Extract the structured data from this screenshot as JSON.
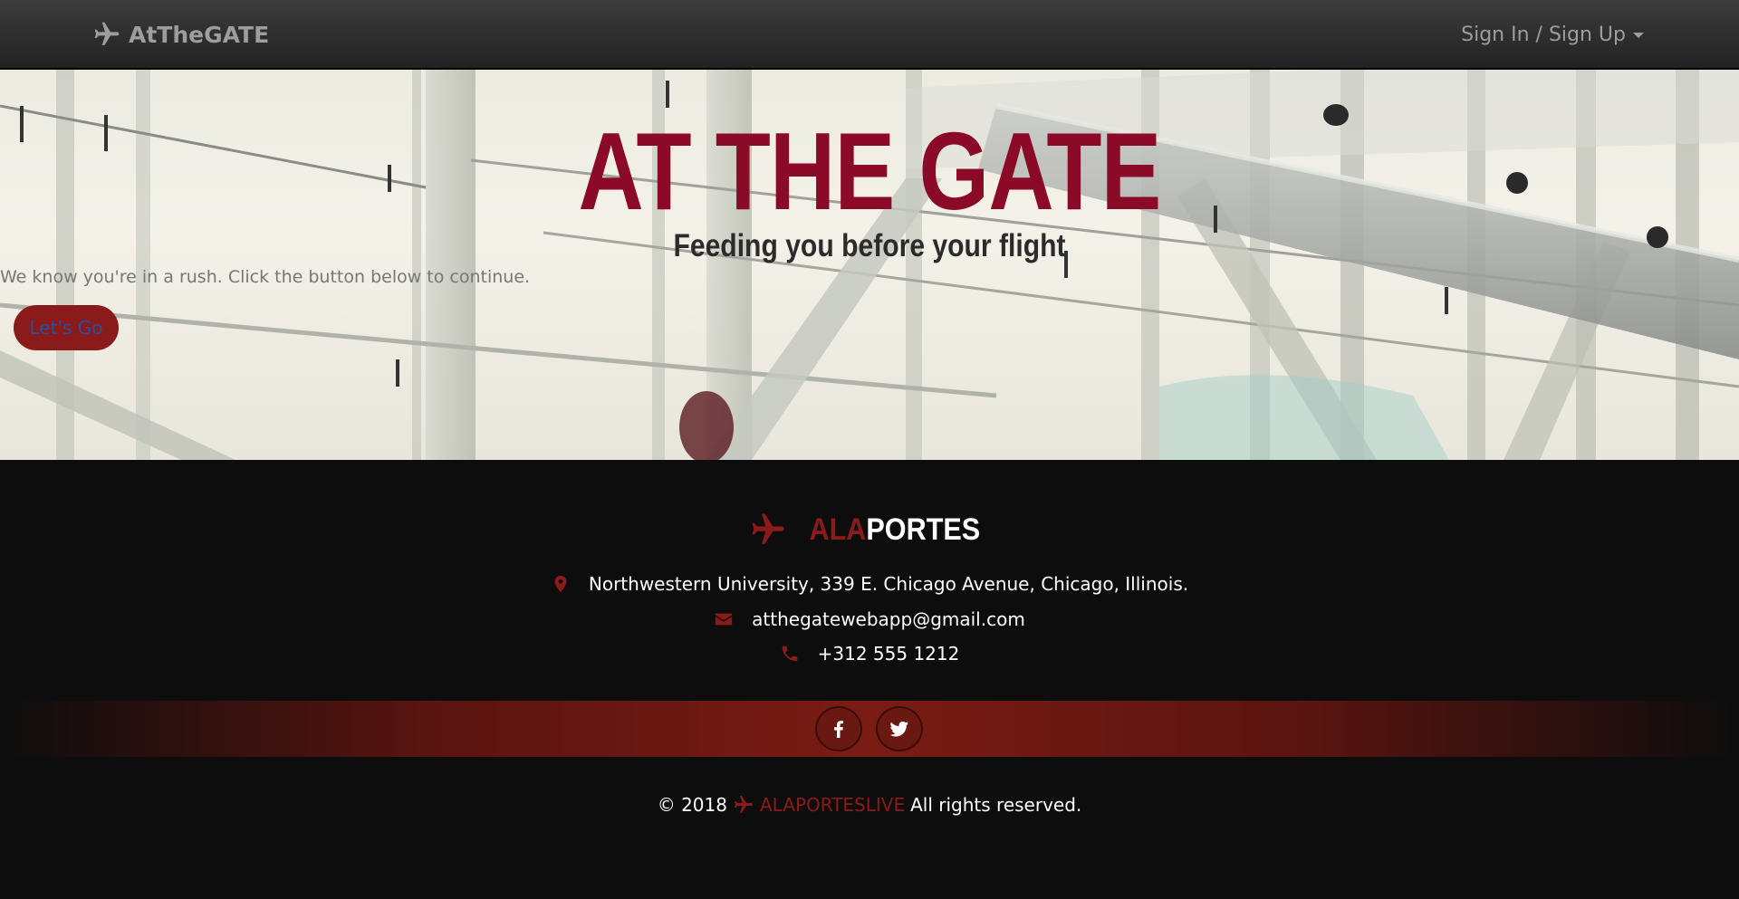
{
  "nav": {
    "brand": "AtTheGATE",
    "account_menu": "Sign In / Sign Up"
  },
  "hero": {
    "title": "AT THE GATE",
    "subtitle": "Feeding you before your flight",
    "text": "We know you're in a rush. Click the button below to continue.",
    "cta": "Let's Go"
  },
  "footer": {
    "brand_red": "ALA",
    "brand_white": "PORTES",
    "address": "Northwestern University, 339 E. Chicago Avenue, Chicago, Illinois.",
    "email": "atthegatewebapp@gmail.com",
    "phone": "+312 555 1212",
    "social": [
      "facebook-icon",
      "twitter-icon"
    ],
    "copyright_year": "© 2018",
    "copyright_brand": "ALAPORTESLIVE",
    "copyright_text": "All rights reserved."
  },
  "colors": {
    "accent": "#8b0a27",
    "footer_accent": "#8b1a1a",
    "navbar": "#2b2b2b",
    "footer_bg": "#0d0d0d"
  }
}
